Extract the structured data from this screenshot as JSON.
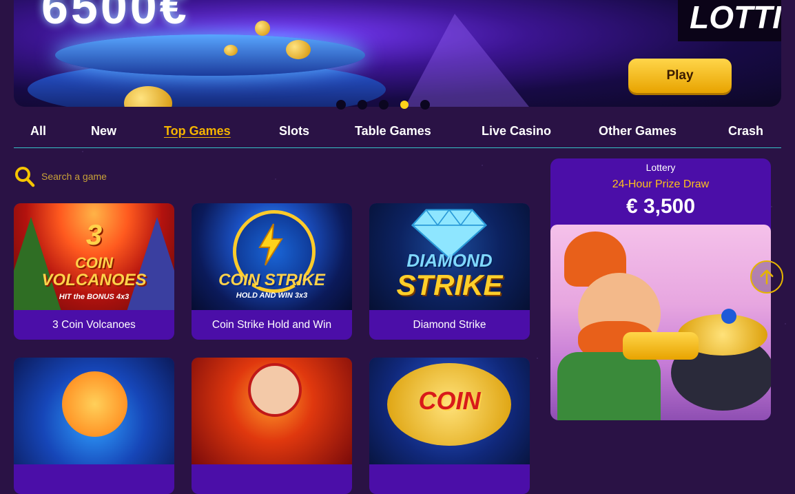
{
  "banner": {
    "big_text": "6500€",
    "brand_text": "LOTTI",
    "play_label": "Play",
    "slides_total": 5,
    "slide_active": 4
  },
  "tabs": [
    {
      "label": "All",
      "active": false
    },
    {
      "label": "New",
      "active": false
    },
    {
      "label": "Top Games",
      "active": true
    },
    {
      "label": "Slots",
      "active": false
    },
    {
      "label": "Table Games",
      "active": false
    },
    {
      "label": "Live Casino",
      "active": false
    },
    {
      "label": "Other Games",
      "active": false
    },
    {
      "label": "Crash",
      "active": false
    }
  ],
  "search": {
    "placeholder": "Search a game"
  },
  "games": [
    {
      "title": "3 Coin Volcanoes",
      "art_line1": "3",
      "art_line2": "COIN",
      "art_line3": "VOLCANOES",
      "art_line4": "HIT the BONUS 4x3"
    },
    {
      "title": "Coin Strike Hold and Win",
      "art_line1": "COIN STRIKE",
      "art_line2": "HOLD AND WIN 3x3"
    },
    {
      "title": "Diamond Strike",
      "art_line1": "DIAMOND",
      "art_line2": "STRIKE"
    },
    {
      "title": "",
      "art_line1": ""
    },
    {
      "title": "",
      "art_line1": ""
    },
    {
      "title": "",
      "art_line1": "COIN"
    }
  ],
  "lottery": {
    "title": "Lottery",
    "subtitle": "24-Hour Prize Draw",
    "amount": "€ 3,500"
  },
  "colors": {
    "accent": "#f5b400",
    "card_bg": "#4b0ea8",
    "divider": "#36c4c8",
    "page_bg": "#2a1245"
  }
}
